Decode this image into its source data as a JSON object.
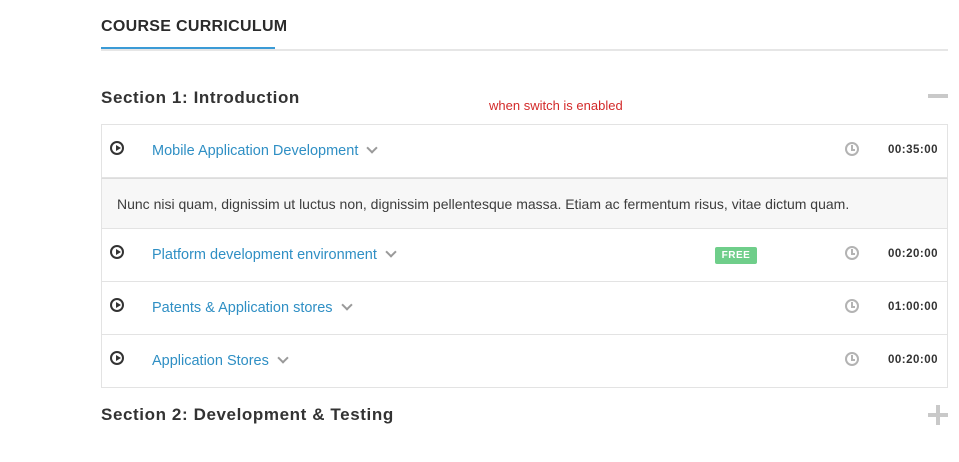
{
  "header": {
    "tab_label": "COURSE CURRICULUM"
  },
  "annotation": "when switch is enabled",
  "sections": [
    {
      "title": "Section 1: Introduction",
      "expanded": true,
      "lessons": [
        {
          "title": "Mobile Application Development",
          "duration": "00:35:00",
          "description": "Nunc nisi quam, dignissim ut luctus non, dignissim pellentesque massa. Etiam ac fermentum risus, vitae dictum quam."
        },
        {
          "title": "Platform development environment",
          "duration": "00:20:00",
          "badge": "FREE"
        },
        {
          "title": "Patents & Application stores",
          "duration": "01:00:00"
        },
        {
          "title": "Application Stores",
          "duration": "00:20:00"
        }
      ]
    },
    {
      "title": "Section 2: Development & Testing",
      "expanded": false
    }
  ],
  "colors": {
    "link": "#2f8fc4",
    "badge": "#6fce8a",
    "accent": "#3b9bd6",
    "annotation": "#d32a2a"
  },
  "icons": [
    "play-icon",
    "chevron-down-icon",
    "clock-icon",
    "minus-icon",
    "plus-icon"
  ]
}
